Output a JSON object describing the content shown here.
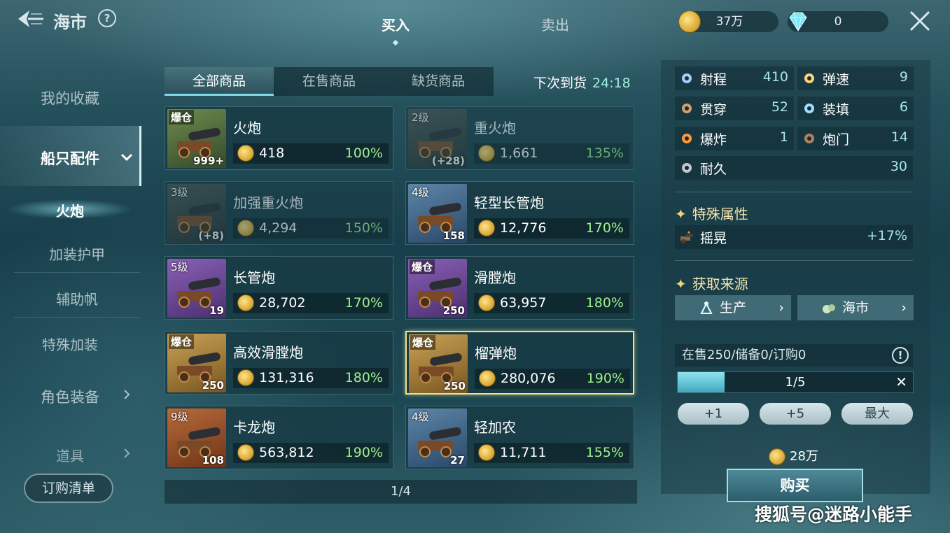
{
  "header": {
    "title": "海市",
    "help": "?",
    "tabs": [
      {
        "label": "买入"
      },
      {
        "label": "卖出"
      }
    ],
    "gold": "37万",
    "diamond": "0"
  },
  "sidebar": {
    "items": [
      "我的收藏",
      "船只配件",
      "火炮",
      "加装护甲",
      "辅助帆",
      "特殊加装",
      "角色装备",
      "道具"
    ],
    "order_button": "订购清单"
  },
  "filters": {
    "tabs": [
      "全部商品",
      "在售商品",
      "缺货商品"
    ],
    "restock_label": "下次到货",
    "restock_time": "24:18"
  },
  "items": [
    {
      "badge": "爆仓",
      "name": "火炮",
      "qty": "999+",
      "price": "418",
      "pct": "100%"
    },
    {
      "badge": "2级",
      "name": "重火炮",
      "qty": "(+28)",
      "price": "1,661",
      "pct": "135%"
    },
    {
      "badge": "3级",
      "name": "加强重火炮",
      "qty": "(+8)",
      "price": "4,294",
      "pct": "150%"
    },
    {
      "badge": "4级",
      "name": "轻型长管炮",
      "qty": "158",
      "price": "12,776",
      "pct": "170%"
    },
    {
      "badge": "5级",
      "name": "长管炮",
      "qty": "19",
      "price": "28,702",
      "pct": "170%"
    },
    {
      "badge": "爆仓",
      "name": "滑膛炮",
      "qty": "250",
      "price": "63,957",
      "pct": "180%"
    },
    {
      "badge": "爆仓",
      "name": "高效滑膛炮",
      "qty": "250",
      "price": "131,316",
      "pct": "180%"
    },
    {
      "badge": "爆仓",
      "name": "榴弹炮",
      "qty": "250",
      "price": "280,076",
      "pct": "190%"
    },
    {
      "badge": "9级",
      "name": "卡龙炮",
      "qty": "108",
      "price": "563,812",
      "pct": "190%"
    },
    {
      "badge": "4级",
      "name": "轻加农",
      "qty": "27",
      "price": "11,711",
      "pct": "155%"
    }
  ],
  "pager": "1/4",
  "stats": [
    {
      "label": "射程",
      "value": "410"
    },
    {
      "label": "弹速",
      "value": "9"
    },
    {
      "label": "贯穿",
      "value": "52"
    },
    {
      "label": "装填",
      "value": "6"
    },
    {
      "label": "爆炸",
      "value": "1"
    },
    {
      "label": "炮门",
      "value": "14"
    },
    {
      "label": "耐久",
      "value": "30"
    }
  ],
  "special": {
    "title": "特殊属性",
    "attr_label": "摇晃",
    "attr_value": "+17%"
  },
  "source": {
    "title": "获取来源",
    "buttons": [
      "生产",
      "海市"
    ]
  },
  "stock_info": "在售250/储备0/订购0",
  "quantity": {
    "text": "1/5",
    "fraction": 0.2
  },
  "qty_buttons": [
    "+1",
    "+5",
    "最大"
  ],
  "total": "28万",
  "buy_label": "购买",
  "watermark": "搜狐号@迷路小能手"
}
